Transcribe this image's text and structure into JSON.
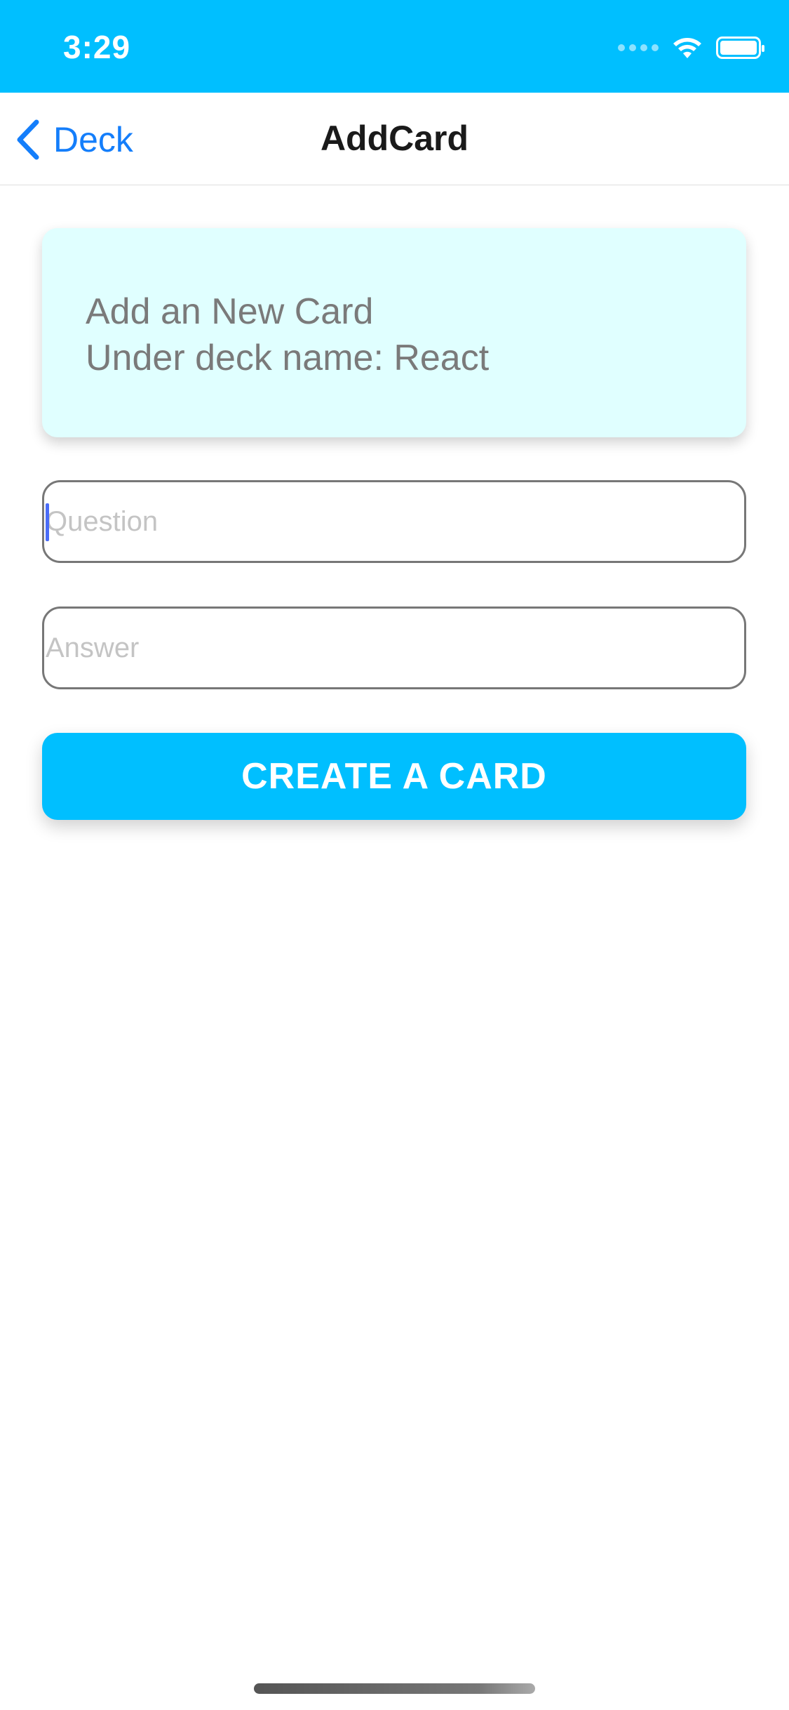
{
  "status_bar": {
    "time": "3:29",
    "background_color": "#00BFFF",
    "icons": [
      "signal-dots-icon",
      "wifi-icon",
      "battery-icon"
    ]
  },
  "nav": {
    "back_label": "Deck",
    "back_icon": "chevron-left-icon",
    "title": "AddCard",
    "accent_color": "#147EFB"
  },
  "info_card": {
    "line1": "Add an New Card",
    "line2": "Under deck name: React",
    "background_color": "#E0FFFF"
  },
  "form": {
    "question": {
      "placeholder": "Question",
      "value": ""
    },
    "answer": {
      "placeholder": "Answer",
      "value": ""
    }
  },
  "create_button": {
    "label": "CREATE A CARD",
    "background_color": "#00BFFF"
  }
}
